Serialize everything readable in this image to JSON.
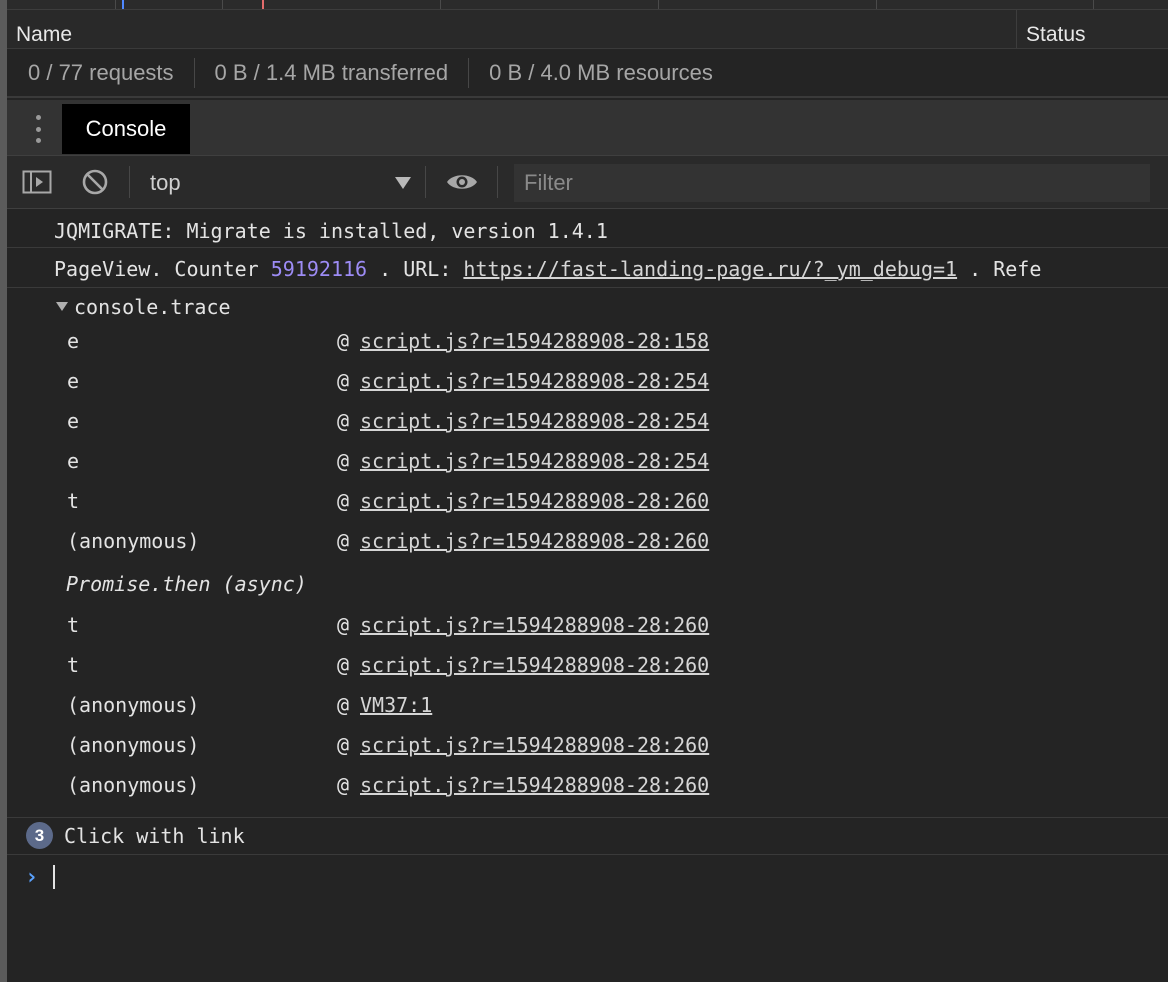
{
  "network": {
    "columns": {
      "name": "Name",
      "status": "Status"
    },
    "summary": {
      "requests": "0 / 77 requests",
      "transferred": "0 B / 1.4 MB transferred",
      "resources": "0 B / 4.0 MB resources"
    }
  },
  "drawer": {
    "more_icon": "kebab-icon",
    "active_tab": "Console"
  },
  "toolbar": {
    "sidebar_icon": "sidebar-toggle-icon",
    "clear_icon": "block-icon",
    "context": "top",
    "live_expression_icon": "eye-icon",
    "filter_placeholder": "Filter"
  },
  "messages": {
    "jqmigrate": "JQMIGRATE: Migrate is installed, version 1.4.1",
    "pageview": {
      "prefix": "PageView. Counter ",
      "counter": "59192116",
      "mid": " . URL: ",
      "url": "https://fast-landing-page.ru/?_ym_debug=1",
      "suffix": " . Refe"
    },
    "trace": {
      "label": "console.trace",
      "frames_before_async": [
        {
          "fn": "e",
          "at": "@",
          "loc": "script.js?r=1594288908-28:158"
        },
        {
          "fn": "e",
          "at": "@",
          "loc": "script.js?r=1594288908-28:254"
        },
        {
          "fn": "e",
          "at": "@",
          "loc": "script.js?r=1594288908-28:254"
        },
        {
          "fn": "e",
          "at": "@",
          "loc": "script.js?r=1594288908-28:254"
        },
        {
          "fn": "t",
          "at": "@",
          "loc": "script.js?r=1594288908-28:260"
        },
        {
          "fn": "(anonymous)",
          "at": "@",
          "loc": "script.js?r=1594288908-28:260"
        }
      ],
      "async_label": "Promise.then (async)",
      "frames_after_async": [
        {
          "fn": "t",
          "at": "@",
          "loc": "script.js?r=1594288908-28:260"
        },
        {
          "fn": "t",
          "at": "@",
          "loc": "script.js?r=1594288908-28:260"
        },
        {
          "fn": "(anonymous)",
          "at": "@",
          "loc": "VM37:1"
        },
        {
          "fn": "(anonymous)",
          "at": "@",
          "loc": "script.js?r=1594288908-28:260"
        },
        {
          "fn": "(anonymous)",
          "at": "@",
          "loc": "script.js?r=1594288908-28:260"
        }
      ]
    },
    "grouped": {
      "count": "3",
      "text": "Click with link"
    }
  },
  "prompt": {
    "symbol": "›"
  },
  "colors": {
    "background": "#242424",
    "counter_number": "#9d8cf5",
    "prompt_chevron": "#5aa2ff",
    "badge": "#5c6a8a"
  }
}
